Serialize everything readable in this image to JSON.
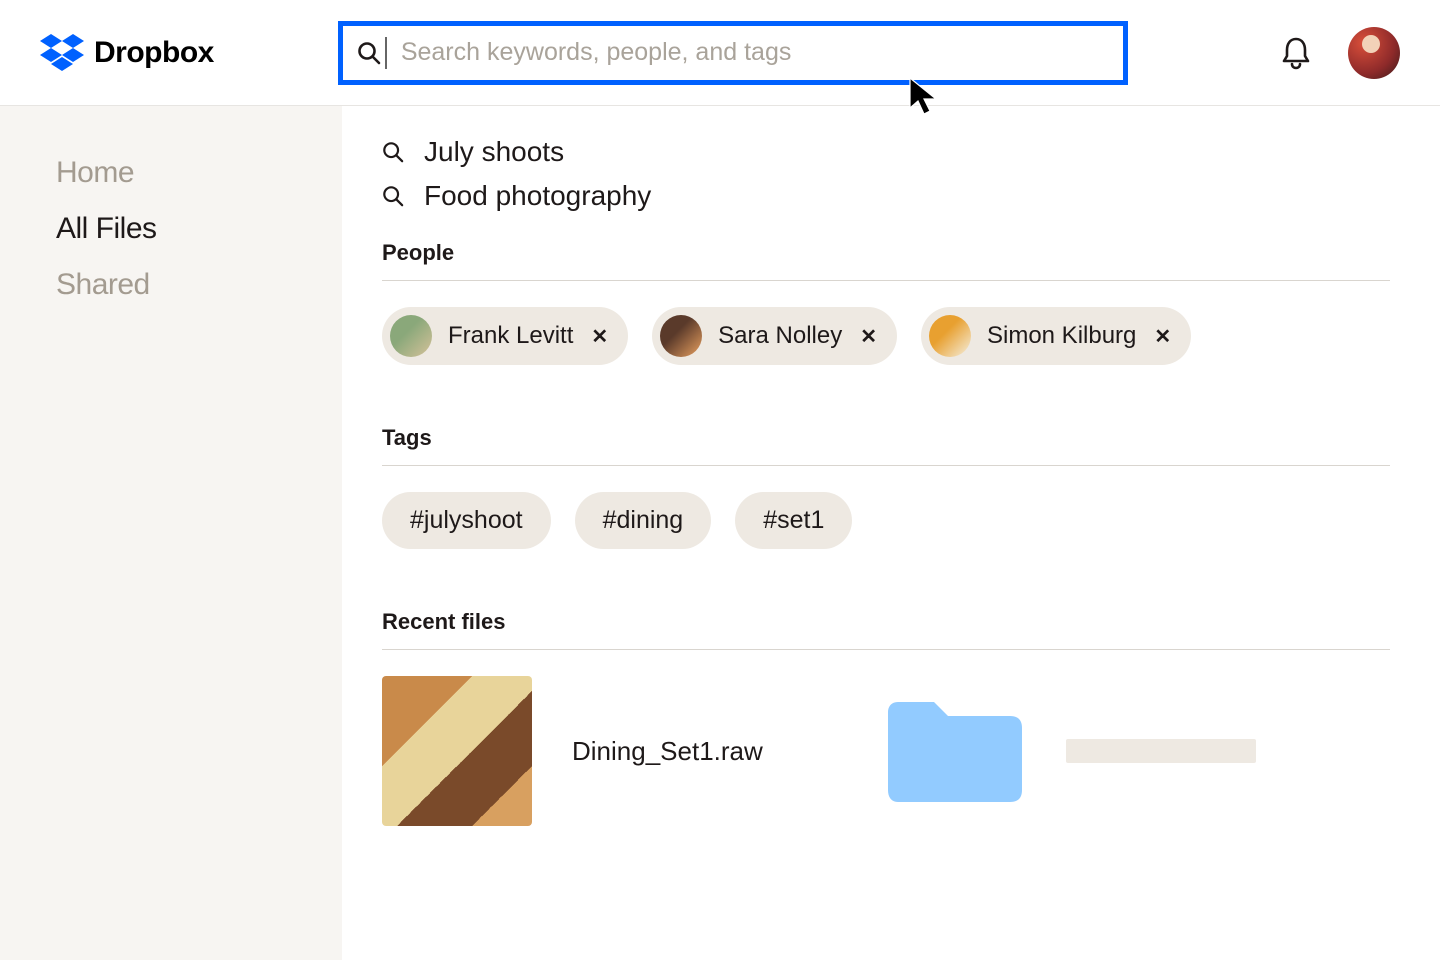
{
  "brand": {
    "name": "Dropbox"
  },
  "search": {
    "placeholder": "Search keywords, people, and tags",
    "value": ""
  },
  "sidebar": {
    "items": [
      {
        "label": "Home",
        "active": false
      },
      {
        "label": "All Files",
        "active": true
      },
      {
        "label": "Shared",
        "active": false
      }
    ]
  },
  "suggestions": [
    {
      "label": "July shoots"
    },
    {
      "label": "Food photography"
    }
  ],
  "sections": {
    "people_title": "People",
    "tags_title": "Tags",
    "recent_title": "Recent files"
  },
  "people": [
    {
      "name": "Frank Levitt"
    },
    {
      "name": "Sara Nolley"
    },
    {
      "name": "Simon Kilburg"
    }
  ],
  "tags": [
    {
      "label": "#julyshoot"
    },
    {
      "label": "#dining"
    },
    {
      "label": "#set1"
    }
  ],
  "recent": [
    {
      "name": "Dining_Set1.raw"
    }
  ],
  "colors": {
    "accent": "#0061ff",
    "chip_bg": "#eee9e2",
    "sidebar_bg": "#f7f5f2",
    "folder": "#92cbff"
  }
}
